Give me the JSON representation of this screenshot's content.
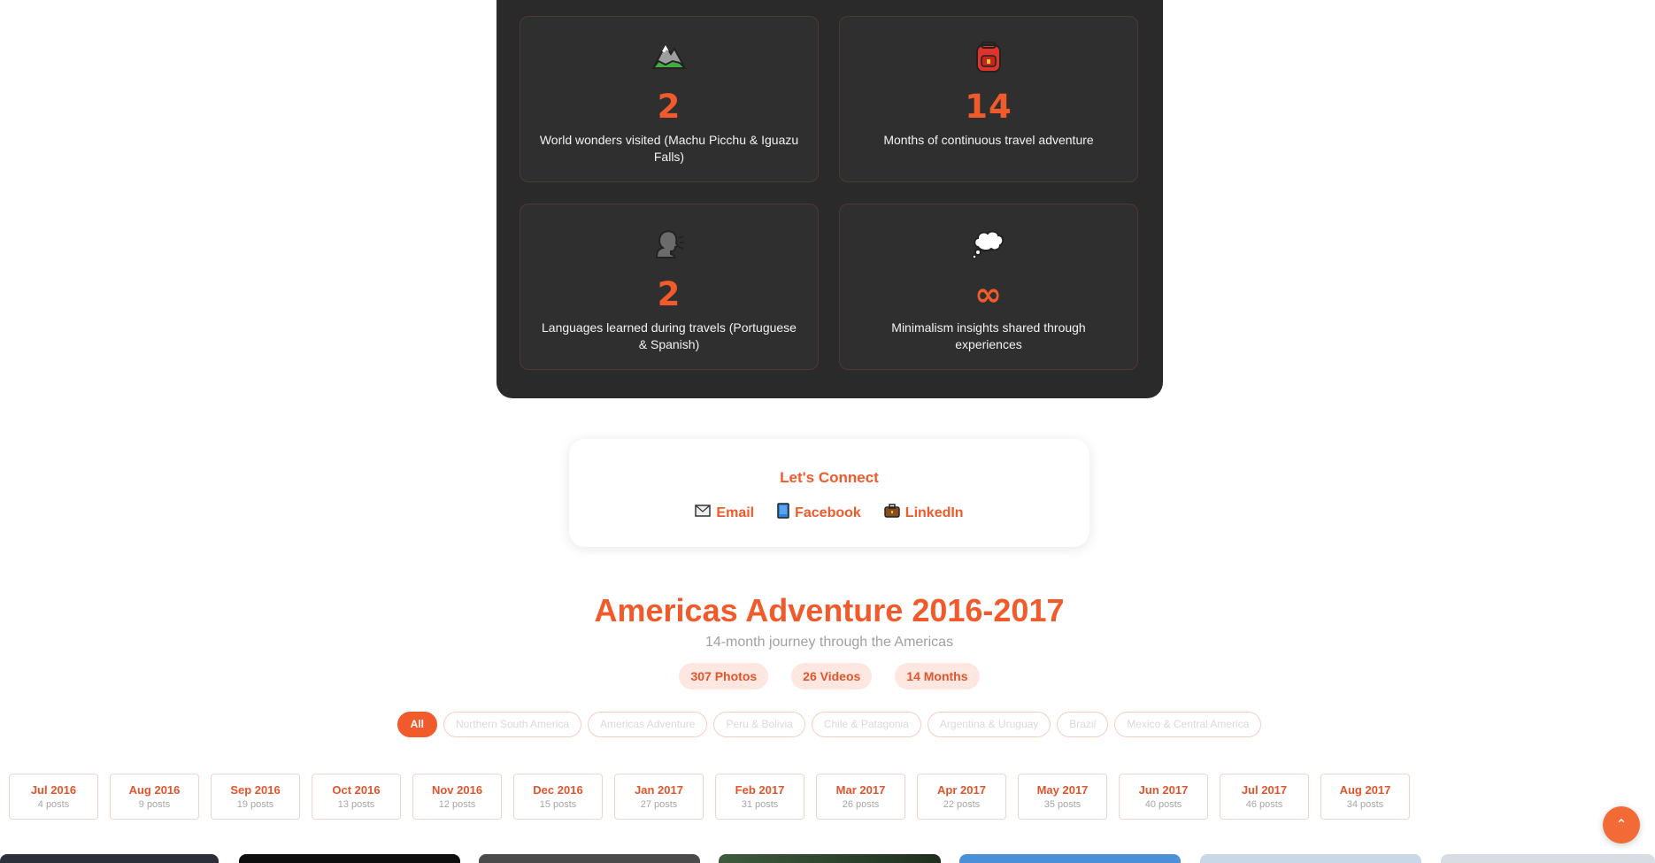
{
  "stats": [
    {
      "icon": "mountain-icon",
      "number": "2",
      "label": "World wonders visited (Machu Picchu & Iguazu Falls)"
    },
    {
      "icon": "backpack-icon",
      "number": "14",
      "label": "Months of continuous travel adventure"
    },
    {
      "icon": "speaking-head-icon",
      "number": "2",
      "label": "Languages learned during travels (Portuguese & Spanish)"
    },
    {
      "icon": "thought-bubble-icon",
      "number": "∞",
      "label": "Minimalism insights shared through experiences"
    }
  ],
  "connect": {
    "title": "Let's Connect",
    "links": [
      {
        "icon": "envelope-icon",
        "label": "Email"
      },
      {
        "icon": "blue-book-icon",
        "label": "Facebook"
      },
      {
        "icon": "briefcase-icon",
        "label": "LinkedIn"
      }
    ]
  },
  "adventure": {
    "title": "Americas Adventure 2016-2017",
    "subtitle": "14-month journey through the Americas",
    "pills": [
      "307 Photos",
      "26 Videos",
      "14 Months"
    ]
  },
  "filters": {
    "active": "All",
    "items": [
      "All",
      "Northern South America",
      "Americas Adventure",
      "Peru & Bolivia",
      "Chile & Patagonia",
      "Argentina & Uruguay",
      "Brazil",
      "Mexico & Central America"
    ]
  },
  "months": [
    {
      "name": "Jul 2016",
      "count": "4 posts"
    },
    {
      "name": "Aug 2016",
      "count": "9 posts"
    },
    {
      "name": "Sep 2016",
      "count": "19 posts"
    },
    {
      "name": "Oct 2016",
      "count": "13 posts"
    },
    {
      "name": "Nov 2016",
      "count": "12 posts"
    },
    {
      "name": "Dec 2016",
      "count": "15 posts"
    },
    {
      "name": "Jan 2017",
      "count": "27 posts"
    },
    {
      "name": "Feb 2017",
      "count": "31 posts"
    },
    {
      "name": "Mar 2017",
      "count": "26 posts"
    },
    {
      "name": "Apr 2017",
      "count": "22 posts"
    },
    {
      "name": "May 2017",
      "count": "35 posts"
    },
    {
      "name": "Jun 2017",
      "count": "40 posts"
    },
    {
      "name": "Jul 2017",
      "count": "46 posts"
    },
    {
      "name": "Aug 2017",
      "count": "34 posts"
    }
  ],
  "scroll_top": {
    "icon": "chevron-up-icon",
    "glyph": "⌃"
  },
  "colors": {
    "accent": "#f15a2b",
    "panel": "#2a2a2a"
  }
}
